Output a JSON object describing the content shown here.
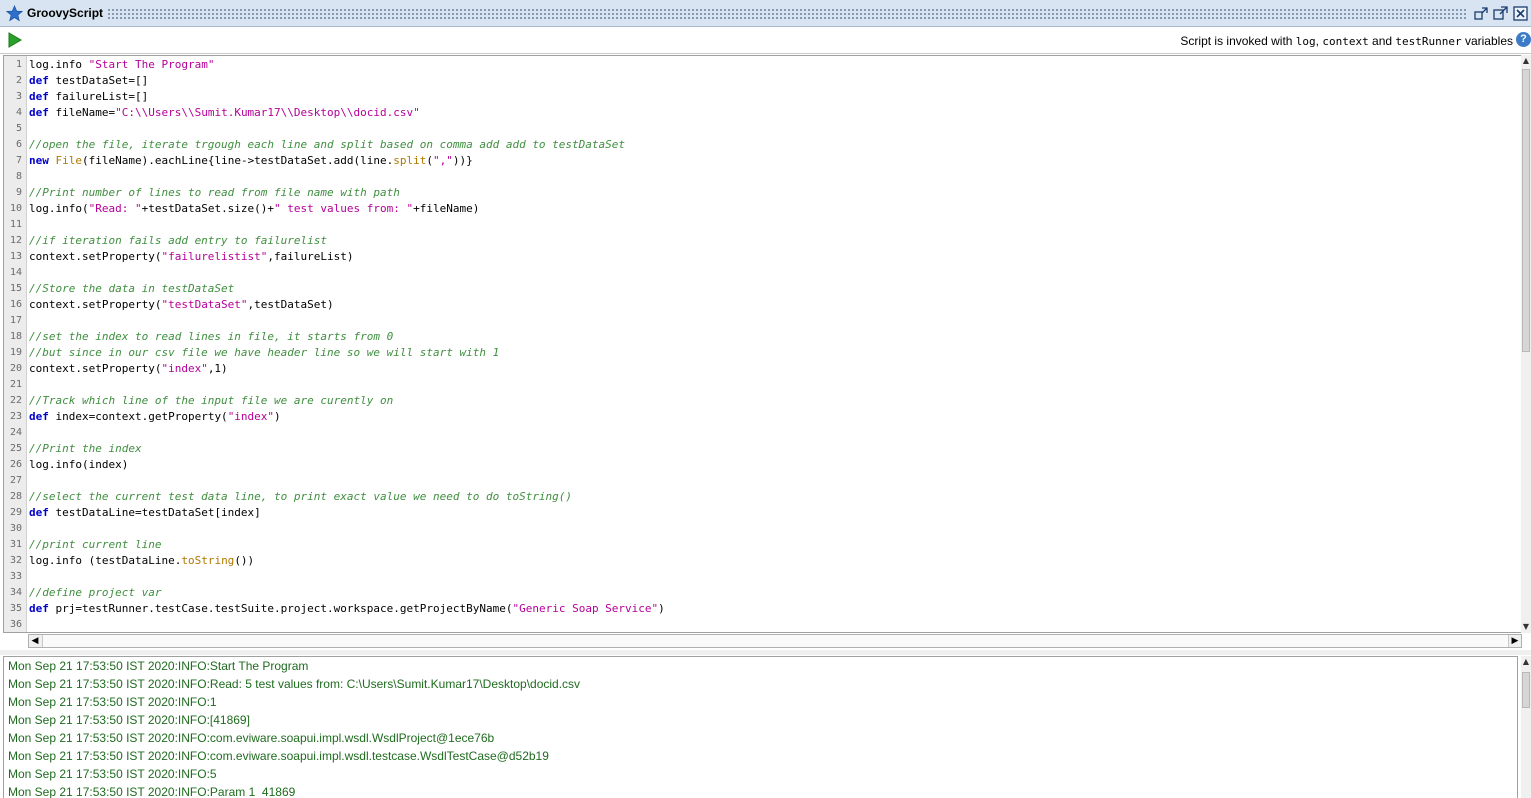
{
  "window": {
    "title": "GroovyScript"
  },
  "toolbar": {
    "hint_prefix": "Script is invoked with ",
    "hint_var1": "log",
    "hint_sep1": ", ",
    "hint_var2": "context",
    "hint_sep2": " and ",
    "hint_var3": "testRunner",
    "hint_suffix": " variables"
  },
  "editor": {
    "lines": [
      {
        "n": "1",
        "parts": [
          [
            "pl",
            "log.info "
          ],
          [
            "str",
            "\"Start The Program\""
          ]
        ]
      },
      {
        "n": "2",
        "parts": [
          [
            "kw",
            "def"
          ],
          [
            "pl",
            " testDataSet=[]"
          ]
        ]
      },
      {
        "n": "3",
        "parts": [
          [
            "kw",
            "def"
          ],
          [
            "pl",
            " failureList=[]"
          ]
        ]
      },
      {
        "n": "4",
        "parts": [
          [
            "kw",
            "def"
          ],
          [
            "pl",
            " fileName="
          ],
          [
            "str",
            "\"C:\\\\Users\\\\Sumit.Kumar17\\\\Desktop\\\\docid.csv\""
          ]
        ]
      },
      {
        "n": "5",
        "parts": []
      },
      {
        "n": "6",
        "parts": [
          [
            "cm",
            "//open the file, iterate trgough each line and split based on comma add add to testDataSet"
          ]
        ]
      },
      {
        "n": "7",
        "parts": [
          [
            "kw",
            "new"
          ],
          [
            "pl",
            " "
          ],
          [
            "ty",
            "File"
          ],
          [
            "pl",
            "(fileName).eachLine{line->testDataSet.add(line."
          ],
          [
            "ty",
            "split"
          ],
          [
            "pl",
            "("
          ],
          [
            "str",
            "\",\""
          ],
          [
            "pl",
            "))}"
          ]
        ]
      },
      {
        "n": "8",
        "parts": []
      },
      {
        "n": "9",
        "parts": [
          [
            "cm",
            "//Print number of lines to read from file name with path"
          ]
        ]
      },
      {
        "n": "10",
        "parts": [
          [
            "pl",
            "log.info("
          ],
          [
            "str",
            "\"Read: \""
          ],
          [
            "pl",
            "+testDataSet.size()+"
          ],
          [
            "str",
            "\" test values from: \""
          ],
          [
            "pl",
            "+fileName)"
          ]
        ]
      },
      {
        "n": "11",
        "parts": []
      },
      {
        "n": "12",
        "parts": [
          [
            "cm",
            "//if iteration fails add entry to failurelist"
          ]
        ]
      },
      {
        "n": "13",
        "parts": [
          [
            "pl",
            "context.setProperty("
          ],
          [
            "str",
            "\"failurelistist\""
          ],
          [
            "pl",
            ",failureList)"
          ]
        ]
      },
      {
        "n": "14",
        "parts": []
      },
      {
        "n": "15",
        "parts": [
          [
            "cm",
            "//Store the data in testDataSet"
          ]
        ]
      },
      {
        "n": "16",
        "parts": [
          [
            "pl",
            "context.setProperty("
          ],
          [
            "str",
            "\"testDataSet\""
          ],
          [
            "pl",
            ",testDataSet)"
          ]
        ]
      },
      {
        "n": "17",
        "parts": []
      },
      {
        "n": "18",
        "parts": [
          [
            "cm",
            "//set the index to read lines in file, it starts from 0"
          ]
        ]
      },
      {
        "n": "19",
        "parts": [
          [
            "cm",
            "//but since in our csv file we have header line so we will start with 1"
          ]
        ]
      },
      {
        "n": "20",
        "parts": [
          [
            "pl",
            "context.setProperty("
          ],
          [
            "str",
            "\"index\""
          ],
          [
            "pl",
            ",1)"
          ]
        ]
      },
      {
        "n": "21",
        "parts": []
      },
      {
        "n": "22",
        "parts": [
          [
            "cm",
            "//Track which line of the input file we are curently on"
          ]
        ]
      },
      {
        "n": "23",
        "parts": [
          [
            "kw",
            "def"
          ],
          [
            "pl",
            " index=context.getProperty("
          ],
          [
            "str",
            "\"index\""
          ],
          [
            "pl",
            ")"
          ]
        ]
      },
      {
        "n": "24",
        "parts": []
      },
      {
        "n": "25",
        "parts": [
          [
            "cm",
            "//Print the index"
          ]
        ]
      },
      {
        "n": "26",
        "parts": [
          [
            "pl",
            "log.info(index)"
          ]
        ]
      },
      {
        "n": "27",
        "parts": []
      },
      {
        "n": "28",
        "parts": [
          [
            "cm",
            "//select the current test data line, to print exact value we need to do toString()"
          ]
        ]
      },
      {
        "n": "29",
        "parts": [
          [
            "kw",
            "def"
          ],
          [
            "pl",
            " testDataLine=testDataSet[index]"
          ]
        ]
      },
      {
        "n": "30",
        "parts": []
      },
      {
        "n": "31",
        "parts": [
          [
            "cm",
            "//print current line"
          ]
        ]
      },
      {
        "n": "32",
        "parts": [
          [
            "pl",
            "log.info (testDataLine."
          ],
          [
            "ty",
            "toString"
          ],
          [
            "pl",
            "())"
          ]
        ]
      },
      {
        "n": "33",
        "parts": []
      },
      {
        "n": "34",
        "parts": [
          [
            "cm",
            "//define project var"
          ]
        ]
      },
      {
        "n": "35",
        "parts": [
          [
            "kw",
            "def"
          ],
          [
            "pl",
            " prj=testRunner.testCase.testSuite.project.workspace.getProjectByName("
          ],
          [
            "str",
            "\"Generic Soap Service\""
          ],
          [
            "pl",
            ")"
          ]
        ]
      },
      {
        "n": "36",
        "parts": []
      }
    ]
  },
  "log": {
    "lines": [
      "Mon Sep 21 17:53:50 IST 2020:INFO:Start The Program",
      "Mon Sep 21 17:53:50 IST 2020:INFO:Read: 5 test values from: C:\\Users\\Sumit.Kumar17\\Desktop\\docid.csv",
      "Mon Sep 21 17:53:50 IST 2020:INFO:1",
      "Mon Sep 21 17:53:50 IST 2020:INFO:[41869]",
      "Mon Sep 21 17:53:50 IST 2020:INFO:com.eviware.soapui.impl.wsdl.WsdlProject@1ece76b",
      "Mon Sep 21 17:53:50 IST 2020:INFO:com.eviware.soapui.impl.wsdl.testcase.WsdlTestCase@d52b19",
      "Mon Sep 21 17:53:50 IST 2020:INFO:5",
      "Mon Sep 21 17:53:50 IST 2020:INFO:Param 1  41869"
    ]
  },
  "colors": {
    "keyword": "#0000c8",
    "string": "#b5009a",
    "comment": "#3f8f3f",
    "log_text": "#1f6b1f",
    "titlebar": "#d9e4f2"
  },
  "icons": {
    "title_icon": "star-icon",
    "run": "play-icon",
    "help": "help-icon",
    "window": [
      "restore-icon",
      "detach-icon",
      "close-icon"
    ]
  }
}
